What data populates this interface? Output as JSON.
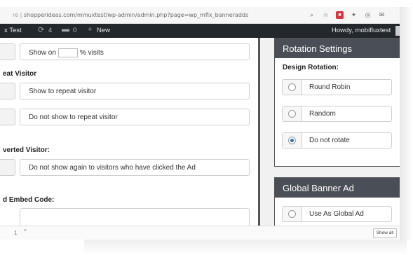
{
  "browser": {
    "url_prefix": "re |",
    "url": "shopperideas.com/mmuxtest/wp-admin/admin.php?page=wp_mflx_banneradds"
  },
  "adminbar": {
    "site_title": "x Test",
    "updates_count": "4",
    "comments_count": "0",
    "new_label": "New",
    "howdy": "Howdy, mobifluxtest"
  },
  "form": {
    "show_on_prefix": "Show on",
    "show_on_suffix": "% visits",
    "repeat_visitor_label": "eat Visitor",
    "show_repeat": "Show to repeat visitor",
    "not_show_repeat": "Do not show to repeat visitor",
    "converted_label": "verted Visitor:",
    "not_show_clicked": "Do not show again to visitors who have clicked the Ad",
    "embed_label": "d Embed Code:"
  },
  "rotation": {
    "title": "Rotation Settings",
    "subtitle": "Design Rotation:",
    "options": [
      {
        "label": "Round Robin",
        "selected": false
      },
      {
        "label": "Random",
        "selected": false
      },
      {
        "label": "Do not rotate",
        "selected": true
      }
    ]
  },
  "global": {
    "title": "Global Banner Ad",
    "option": "Use As Global Ad"
  },
  "bottombar": {
    "page_num": "1",
    "caret": "^",
    "show_all": "Show all"
  }
}
